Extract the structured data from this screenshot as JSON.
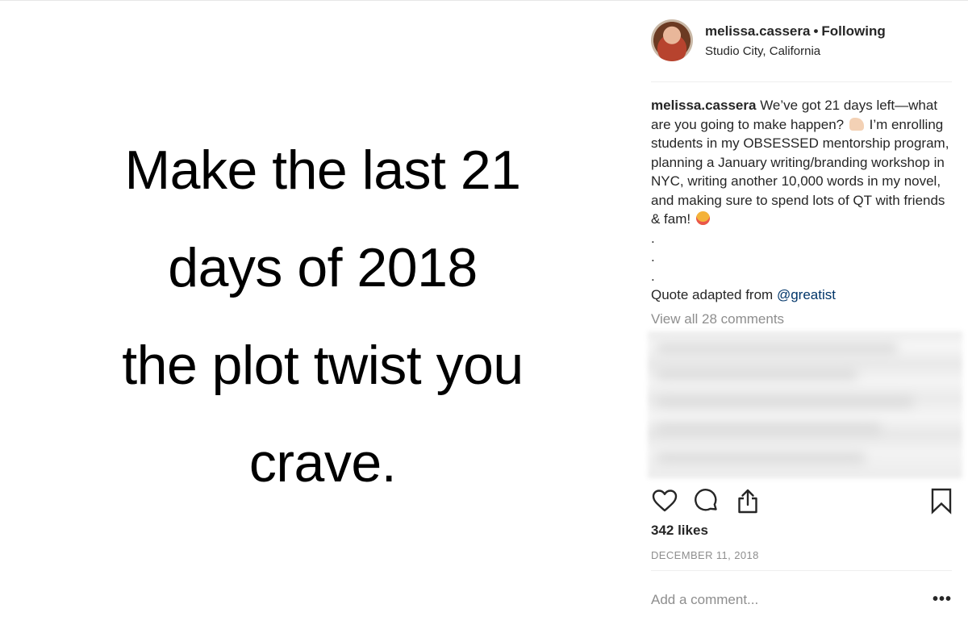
{
  "post_image": {
    "quote_lines": [
      "Make the last 21",
      "days of 2018",
      "the plot twist you",
      "crave."
    ]
  },
  "header": {
    "username": "melissa.cassera",
    "separator": "•",
    "follow_status": "Following",
    "location": "Studio City, California"
  },
  "caption": {
    "username": "melissa.cassera",
    "text_1": "We’ve got 21 days left—what are you going to make happen?",
    "text_2": "I’m enrolling students in my OBSESSED mentorship program, planning a January writing/branding workshop in NYC, writing another 10,000 words in my novel, and making sure to spend lots of QT with friends & fam!",
    "dots": [
      ".",
      ".",
      "."
    ],
    "quote_credit": "Quote adapted from",
    "mention": "@greatist"
  },
  "comments": {
    "view_all": "View all 28 comments"
  },
  "actions": {
    "icons": [
      "heart-icon",
      "comment-icon",
      "share-icon",
      "bookmark-icon"
    ]
  },
  "likes": "342 likes",
  "date": "DECEMBER 11, 2018",
  "comment_box": {
    "placeholder": "Add a comment...",
    "more": "•••"
  },
  "colors": {
    "text": "#262626",
    "muted": "#8e8e8e",
    "mention": "#003569",
    "divider": "#efefef"
  }
}
